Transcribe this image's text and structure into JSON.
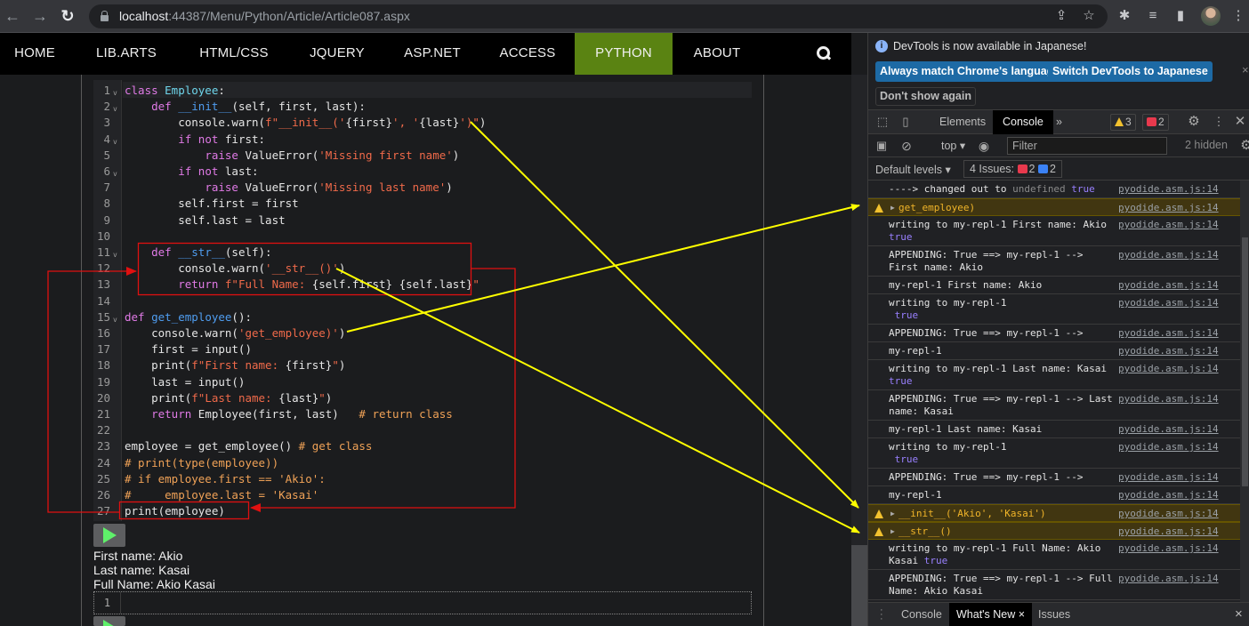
{
  "browser": {
    "url_host": "localhost",
    "url_rest": ":44387/Menu/Python/Article/Article087.aspx",
    "icons": [
      "back-icon",
      "forward-icon",
      "reload-icon",
      "lock-icon",
      "share-icon",
      "bookmark-star-icon",
      "extensions-icon",
      "media-icon",
      "side-panel-icon",
      "profile-avatar",
      "menu-icon"
    ]
  },
  "sitenav": {
    "items": [
      {
        "label": "HOME"
      },
      {
        "label": "LIB.ARTS"
      },
      {
        "label": "HTML/CSS"
      },
      {
        "label": "JQUERY"
      },
      {
        "label": "ASP.NET"
      },
      {
        "label": "ACCESS"
      },
      {
        "label": "PYTHON",
        "active": true
      },
      {
        "label": "ABOUT"
      }
    ],
    "active_color": "#5a8312"
  },
  "editor": {
    "lines": [
      {
        "n": "1",
        "fold": true
      },
      {
        "n": "2",
        "fold": true
      },
      {
        "n": "3"
      },
      {
        "n": "4",
        "fold": true
      },
      {
        "n": "5"
      },
      {
        "n": "6",
        "fold": true
      },
      {
        "n": "7"
      },
      {
        "n": "8"
      },
      {
        "n": "9"
      },
      {
        "n": "10"
      },
      {
        "n": "11",
        "fold": true
      },
      {
        "n": "12"
      },
      {
        "n": "13"
      },
      {
        "n": "14"
      },
      {
        "n": "15",
        "fold": true
      },
      {
        "n": "16"
      },
      {
        "n": "17"
      },
      {
        "n": "18"
      },
      {
        "n": "19"
      },
      {
        "n": "20"
      },
      {
        "n": "21"
      },
      {
        "n": "22"
      },
      {
        "n": "23"
      },
      {
        "n": "24"
      },
      {
        "n": "25"
      },
      {
        "n": "26"
      },
      {
        "n": "27"
      }
    ],
    "code": [
      [
        [
          "kw",
          "class "
        ],
        [
          "cls",
          "Employee"
        ],
        [
          "",
          ":"
        ]
      ],
      [
        [
          "",
          "    "
        ],
        [
          "kw",
          "def "
        ],
        [
          "fn",
          "__init__"
        ],
        [
          "",
          "(self, first, last):"
        ]
      ],
      [
        [
          "",
          "        console.warn("
        ],
        [
          "str",
          "f\"__init__('"
        ],
        [
          "",
          "{first}"
        ],
        [
          "str",
          "', '"
        ],
        [
          "",
          "{last}"
        ],
        [
          "str",
          "')\""
        ],
        [
          "",
          ")"
        ]
      ],
      [
        [
          "",
          "        "
        ],
        [
          "kw",
          "if not "
        ],
        [
          "",
          "first:"
        ]
      ],
      [
        [
          "",
          "            "
        ],
        [
          "kw",
          "raise "
        ],
        [
          "",
          "ValueError("
        ],
        [
          "str",
          "'Missing first name'"
        ],
        [
          "",
          ")"
        ]
      ],
      [
        [
          "",
          "        "
        ],
        [
          "kw",
          "if not "
        ],
        [
          "",
          "last:"
        ]
      ],
      [
        [
          "",
          "            "
        ],
        [
          "kw",
          "raise "
        ],
        [
          "",
          "ValueError("
        ],
        [
          "str",
          "'Missing last name'"
        ],
        [
          "",
          ")"
        ]
      ],
      [
        [
          "",
          "        self.first = first"
        ]
      ],
      [
        [
          "",
          "        self.last = last"
        ]
      ],
      [
        [
          "",
          ""
        ]
      ],
      [
        [
          "",
          "    "
        ],
        [
          "kw",
          "def "
        ],
        [
          "fn",
          "__str__"
        ],
        [
          "",
          "(self):"
        ]
      ],
      [
        [
          "",
          "        console.warn("
        ],
        [
          "str",
          "'__str__()'"
        ],
        [
          "",
          ")"
        ]
      ],
      [
        [
          "",
          "        "
        ],
        [
          "kw",
          "return "
        ],
        [
          "str",
          "f\"Full Name: "
        ],
        [
          "",
          "{self.first} {self.last}"
        ],
        [
          "str",
          "\""
        ]
      ],
      [
        [
          "",
          ""
        ]
      ],
      [
        [
          "kw",
          "def "
        ],
        [
          "fn",
          "get_employee"
        ],
        [
          "",
          "():"
        ]
      ],
      [
        [
          "",
          "    console.warn("
        ],
        [
          "str",
          "'get_employee)'"
        ],
        [
          "",
          ")"
        ]
      ],
      [
        [
          "",
          "    first = input()"
        ]
      ],
      [
        [
          "",
          "    print("
        ],
        [
          "str",
          "f\"First name: "
        ],
        [
          "",
          "{first}"
        ],
        [
          "str",
          "\""
        ],
        [
          "",
          ")"
        ]
      ],
      [
        [
          "",
          "    last = input()"
        ]
      ],
      [
        [
          "",
          "    print("
        ],
        [
          "str",
          "f\"Last name: "
        ],
        [
          "",
          "{last}"
        ],
        [
          "str",
          "\""
        ],
        [
          "",
          ")"
        ]
      ],
      [
        [
          "",
          "    "
        ],
        [
          "kw",
          "return "
        ],
        [
          "",
          "Employee(first, last)   "
        ],
        [
          "cmt",
          "# return class"
        ]
      ],
      [
        [
          "",
          ""
        ]
      ],
      [
        [
          "",
          "employee = get_employee() "
        ],
        [
          "cmt",
          "# get class"
        ]
      ],
      [
        [
          "cmt",
          "# print(type(employee))"
        ]
      ],
      [
        [
          "cmt",
          "# if employee.first == 'Akio':"
        ]
      ],
      [
        [
          "cmt",
          "#     employee.last = 'Kasai'"
        ]
      ],
      [
        [
          "",
          "print(employee)"
        ]
      ]
    ]
  },
  "output": {
    "lines": [
      "First name: Akio",
      "Last name: Kasai",
      "Full Name: Akio Kasai"
    ]
  },
  "repl2": {
    "line_number": "1"
  },
  "devtools": {
    "infobar": {
      "message": "DevTools is now available in Japanese!",
      "btn_match": "Always match Chrome's language",
      "btn_switch": "Switch DevTools to Japanese",
      "btn_dont_show": "Don't show again",
      "close": "×"
    },
    "tabs": {
      "elements": "Elements",
      "console": "Console",
      "more": "»",
      "warnings_count": "3",
      "errors_count": "2"
    },
    "toolbar": {
      "context": "top ▾",
      "filter_placeholder": "Filter",
      "hidden": "2 hidden",
      "levels": "Default levels ▾",
      "issues_label": "4 Issues:",
      "issues_errors": "2",
      "issues_messages": "2"
    },
    "console_rows": [
      {
        "type": "log",
        "text": "----> changed out to ",
        "extra_undef": "undefined",
        "extra_true": " true",
        "src": "pyodide.asm.js:14"
      },
      {
        "type": "warn",
        "text": "get_employee)",
        "src": "pyodide.asm.js:14"
      },
      {
        "type": "log",
        "text": "writing to my-repl-1 First name: Akio\n",
        "extra_true": "true",
        "src": "pyodide.asm.js:14"
      },
      {
        "type": "log",
        "text": "APPENDING: True ==> my-repl-1 -->\nFirst name: Akio",
        "src": "pyodide.asm.js:14"
      },
      {
        "type": "log",
        "text": "my-repl-1 First name: Akio",
        "src": "pyodide.asm.js:14"
      },
      {
        "type": "log",
        "text": "writing to my-repl-1\n ",
        "extra_true": "true",
        "src": "pyodide.asm.js:14"
      },
      {
        "type": "log",
        "text": "APPENDING: True ==> my-repl-1 -->",
        "src": "pyodide.asm.js:14"
      },
      {
        "type": "log",
        "text": "my-repl-1",
        "src": "pyodide.asm.js:14"
      },
      {
        "type": "log",
        "text": "writing to my-repl-1 Last name: Kasai\n",
        "extra_true": "true",
        "src": "pyodide.asm.js:14"
      },
      {
        "type": "log",
        "text": "APPENDING: True ==> my-repl-1 --> Last\nname: Kasai",
        "src": "pyodide.asm.js:14"
      },
      {
        "type": "log",
        "text": "my-repl-1 Last name: Kasai",
        "src": "pyodide.asm.js:14"
      },
      {
        "type": "log",
        "text": "writing to my-repl-1\n ",
        "extra_true": "true",
        "src": "pyodide.asm.js:14"
      },
      {
        "type": "log",
        "text": "APPENDING: True ==> my-repl-1 -->",
        "src": "pyodide.asm.js:14"
      },
      {
        "type": "log",
        "text": "my-repl-1",
        "src": "pyodide.asm.js:14"
      },
      {
        "type": "warn",
        "text": "__init__('Akio', 'Kasai')",
        "src": "pyodide.asm.js:14"
      },
      {
        "type": "warn",
        "text": "__str__()",
        "src": "pyodide.asm.js:14"
      },
      {
        "type": "log",
        "text": "writing to my-repl-1 Full Name: Akio\nKasai ",
        "extra_true": "true",
        "src": "pyodide.asm.js:14"
      },
      {
        "type": "log",
        "text": "APPENDING: True ==> my-repl-1 --> Full\nName: Akio Kasai",
        "src": "pyodide.asm.js:14"
      }
    ],
    "drawer": {
      "console": "Console",
      "whats_new": "What's New",
      "issues": "Issues",
      "tab_close": "×",
      "close": "×"
    }
  },
  "annotations": {
    "arrow_color": "#ffff00",
    "box_color": "#e01010"
  }
}
